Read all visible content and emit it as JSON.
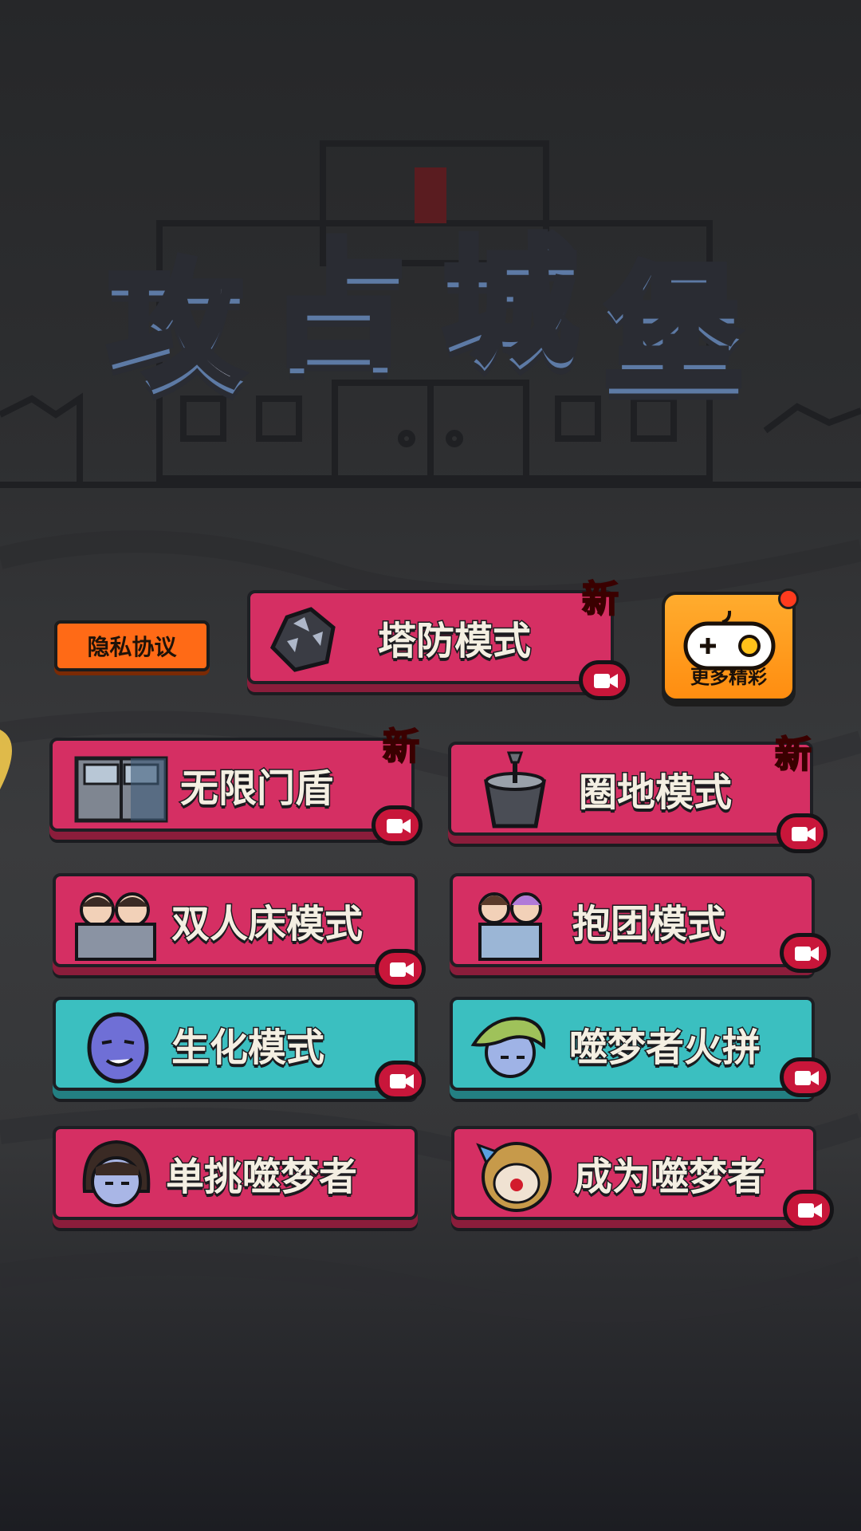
{
  "game_title": [
    "攻",
    "占",
    "城",
    "堡"
  ],
  "privacy_label": "隐私协议",
  "more_games_label": "更多精彩",
  "new_tag": "新",
  "modes": {
    "tower_defense": "塔防模式",
    "infinite_door_shield": "无限门盾",
    "enclosure": "圈地模式",
    "double_bed": "双人床模式",
    "team_up": "抱团模式",
    "biochemical": "生化模式",
    "dream_eater_fight": "噬梦者火拼",
    "solo_dream_eater": "单挑噬梦者",
    "become_dream_eater": "成为噬梦者"
  },
  "colors": {
    "pink_button": "#d52f63",
    "teal_button": "#3bbfc0",
    "privacy_orange": "#ff6a16",
    "new_red": "#d0121c"
  },
  "icons": [
    "ore-rock-icon",
    "metal-door-icon",
    "bucket-shovel-icon",
    "couple-bed-icon",
    "hug-pair-icon",
    "zombie-face-icon",
    "green-hair-face-icon",
    "dark-hair-face-icon",
    "clown-face-icon",
    "video-ad-icon",
    "gamepad-icon"
  ]
}
